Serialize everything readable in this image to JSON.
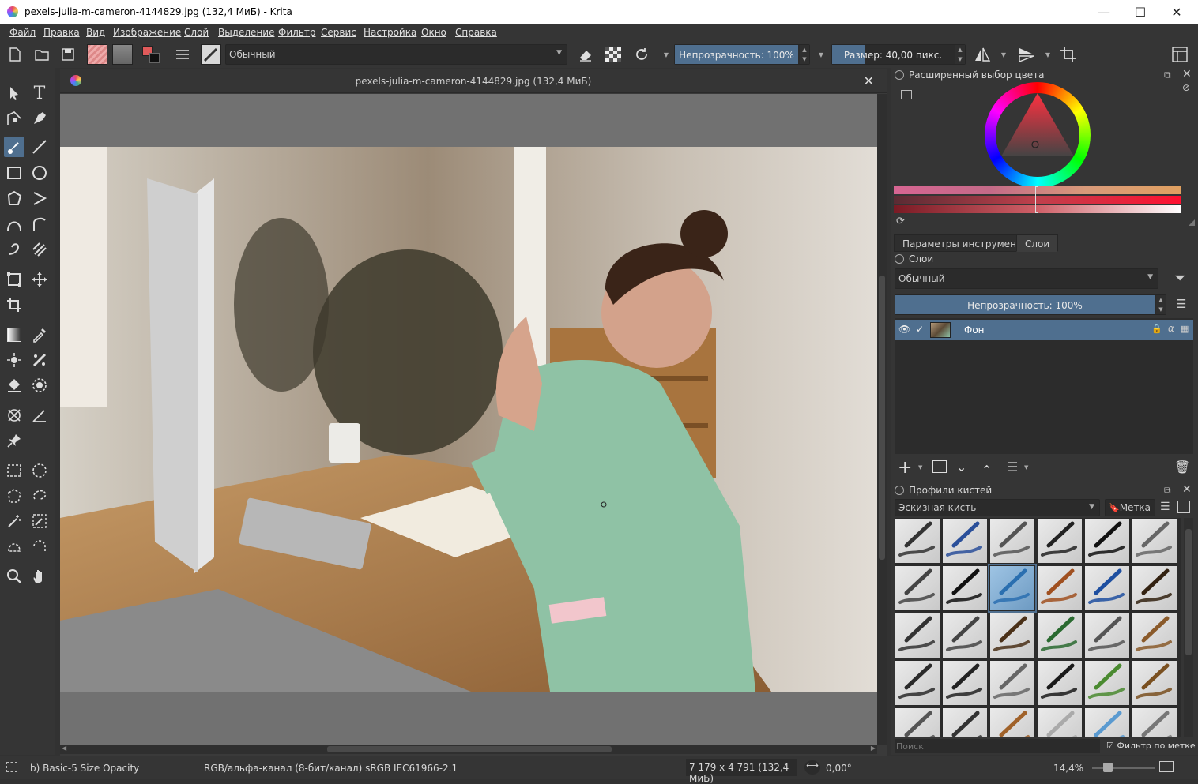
{
  "window": {
    "title": "pexels-julia-m-cameron-4144829.jpg (132,4 МиБ)  - Krita",
    "minimize": "—",
    "maximize": "☐",
    "close": "✕"
  },
  "menu": [
    "Файл",
    "Правка",
    "Вид",
    "Изображение",
    "Слой",
    "Выделение",
    "Фильтр",
    "Сервис",
    "Настройка",
    "Окно",
    "Справка"
  ],
  "toolbar": {
    "blend_mode": "Обычный",
    "opacity_label": "Непрозрачность: 100%",
    "opacity_value": 100,
    "size_label": "Размер: 40,00 пикс.",
    "size_fill": 0.25,
    "fg_color": "#e05a5a",
    "bg_color": "#111111"
  },
  "document": {
    "tab_title": "pexels-julia-m-cameron-4144829.jpg (132,4 МиБ)",
    "close": "✕"
  },
  "color_selector": {
    "title": "Расширенный выбор цвета",
    "current_color": "#c85a64"
  },
  "dock_tabs": [
    "Параметры инструмента",
    "Слои"
  ],
  "layers": {
    "title": "Слои",
    "blend_mode": "Обычный",
    "opacity_label": "Непрозрачность:  100%",
    "items": [
      {
        "name": "Фон",
        "visible": true,
        "checked": true
      }
    ]
  },
  "brush_presets": {
    "title": "Профили кистей",
    "category": "Эскизная кисть",
    "tag_button": "Метка",
    "search_placeholder": "Поиск",
    "filter_by_tag": "Фильтр по метке",
    "filter_checked": true,
    "selected_index": 8
  },
  "status": {
    "brush": "b) Basic-5 Size Opacity",
    "color_model": "RGB/альфа-канал (8-бит/канал)  sRGB IEC61966-2.1",
    "dimensions": "7 179 x 4 791 (132,4 МиБ)",
    "rotation": "0,00°",
    "zoom": "14,4%"
  }
}
